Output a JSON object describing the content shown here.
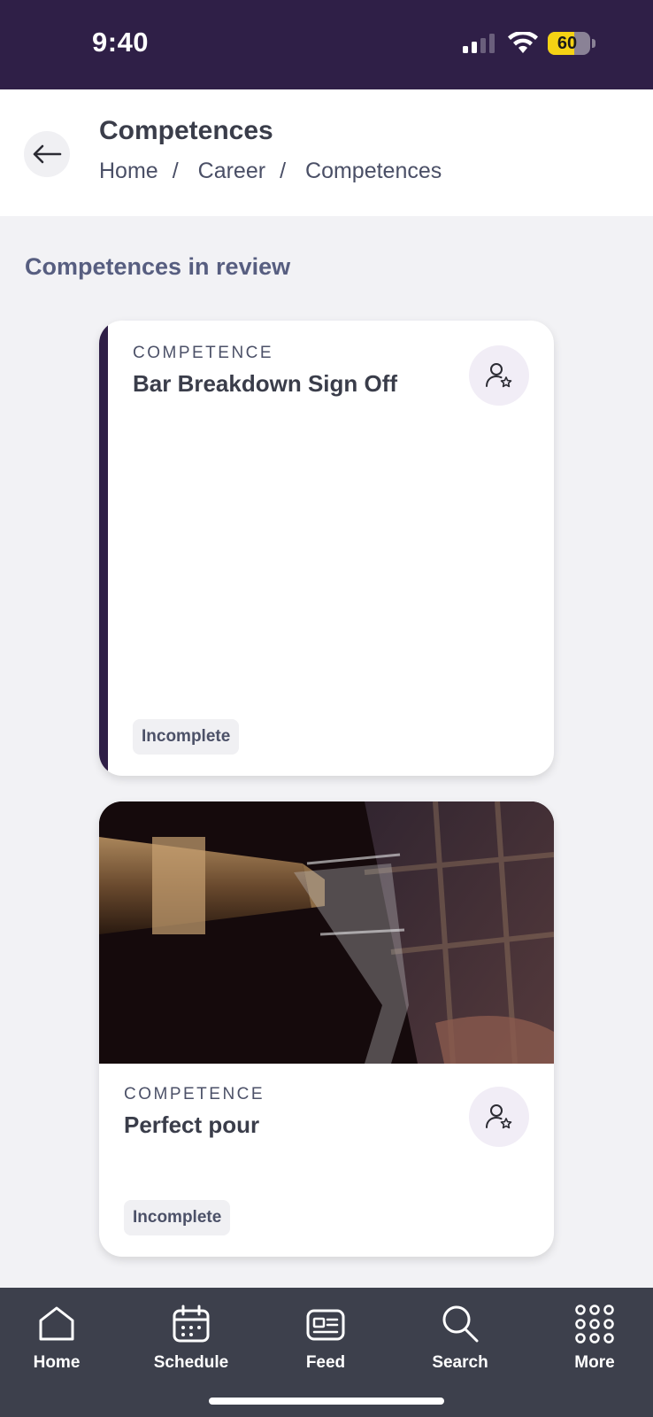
{
  "status_bar": {
    "time": "9:40",
    "battery": "60",
    "icons": [
      "signal-icon",
      "wifi-icon",
      "battery-icon"
    ]
  },
  "header": {
    "title": "Competences",
    "breadcrumb": [
      "Home",
      "Career",
      "Competences"
    ],
    "separator": "/",
    "back_icon": "arrow-left-icon"
  },
  "section": {
    "title": "Competences in review"
  },
  "cards": [
    {
      "label": "COMPETENCE",
      "name": "Bar Breakdown Sign Off",
      "status": "Incomplete",
      "icon": "user-star-icon",
      "accent_color": "#2f1f47"
    },
    {
      "label": "COMPETENCE",
      "name": "Perfect pour",
      "status": "Incomplete",
      "icon": "user-star-icon",
      "image": "pouring-drink-photo"
    }
  ],
  "bottom_nav": [
    {
      "label": "Home",
      "icon": "home-icon"
    },
    {
      "label": "Schedule",
      "icon": "calendar-icon"
    },
    {
      "label": "Feed",
      "icon": "newspaper-icon"
    },
    {
      "label": "Search",
      "icon": "search-icon"
    },
    {
      "label": "More",
      "icon": "grid-dots-icon"
    }
  ],
  "colors": {
    "primary": "#2f1f47",
    "nav_background": "#3d404c",
    "page_background": "#f2f2f5",
    "section_title": "#575e80"
  }
}
